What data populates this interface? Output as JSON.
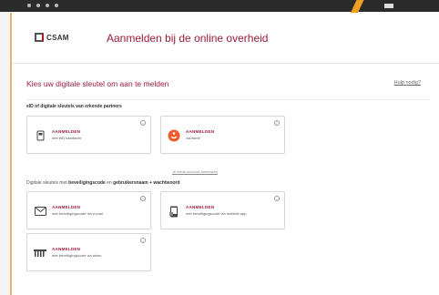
{
  "header": {
    "logo_text": "CSAM",
    "title": "Aanmelden bij de online overheid"
  },
  "main": {
    "section_title": "Kies uw digitale sleutel om aan te melden",
    "help_link": "Hulp nodig?",
    "group1_bold": "eID of digitale sleutels van erkende partners",
    "group2": {
      "prefix": "Digitale sleutels met ",
      "bold1": "beveiligingscode",
      "mid": " en ",
      "bold2": "gebruikersnaam + wachtwoord"
    },
    "cards": [
      {
        "title": "AANMELDEN",
        "subtitle": "met eID kaartlezer",
        "icon": "card-reader-icon"
      },
      {
        "title": "AANMELDEN",
        "subtitle": "via itsme",
        "icon": "itsme-icon"
      },
      {
        "title": "AANMELDEN",
        "subtitle": "met beveiligingscode via e-mail",
        "icon": "email-icon"
      },
      {
        "title": "AANMELDEN",
        "subtitle": "met beveiligingscode via mobiele app",
        "icon": "mobile-app-icon"
      },
      {
        "title": "AANMELDEN",
        "subtitle": "met beveiligingscode via token",
        "icon": "token-icon"
      }
    ],
    "itsme_link": "Je itsme-account aanmaken"
  },
  "colors": {
    "accent": "#a01c3c",
    "itsme": "#ef5b2b",
    "topbar": "#2b2b2b"
  }
}
